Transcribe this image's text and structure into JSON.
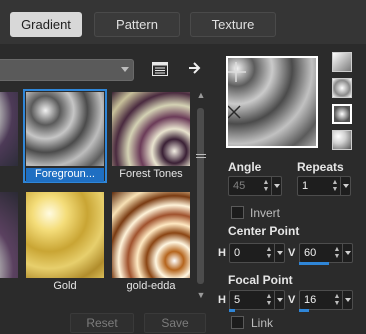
{
  "tabs": [
    {
      "label": "Gradient",
      "active": true
    },
    {
      "label": "Pattern",
      "active": false
    },
    {
      "label": "Texture",
      "active": false
    }
  ],
  "toolbar": {
    "dropdown_value": "",
    "list_icon": "list-view-icon",
    "export_icon": "arrow-right-icon"
  },
  "gradients": [
    {
      "label": "",
      "name": "teal-partial",
      "selected": false
    },
    {
      "label": "Foregroun...",
      "name": "foreground",
      "selected": true
    },
    {
      "label": "Forest Tones",
      "name": "forest-tones",
      "selected": false
    },
    {
      "label": "",
      "name": "teal-partial-2",
      "selected": false
    },
    {
      "label": "Gold",
      "name": "gold",
      "selected": false
    },
    {
      "label": "gold-edda",
      "name": "gold-edda",
      "selected": false
    }
  ],
  "buttons": {
    "reset": "Reset",
    "save": "Save"
  },
  "style_buttons": [
    "linear-style-icon",
    "rectangular-style-icon",
    "sunburst-style-icon",
    "radial-style-icon"
  ],
  "controls": {
    "angle_label": "Angle",
    "angle_value": "45",
    "repeats_label": "Repeats",
    "repeats_value": "1",
    "invert_label": "Invert",
    "invert_checked": false,
    "center_point_label": "Center Point",
    "center_h_label": "H",
    "center_h_value": "0",
    "center_v_label": "V",
    "center_v_value": "60",
    "focal_point_label": "Focal Point",
    "focal_h_label": "H",
    "focal_h_value": "5",
    "focal_v_label": "V",
    "focal_v_value": "16",
    "link_label": "Link",
    "link_checked": false
  },
  "colors": {
    "accent": "#2f86d8",
    "selected_label_bg": "#1f6fc2"
  }
}
